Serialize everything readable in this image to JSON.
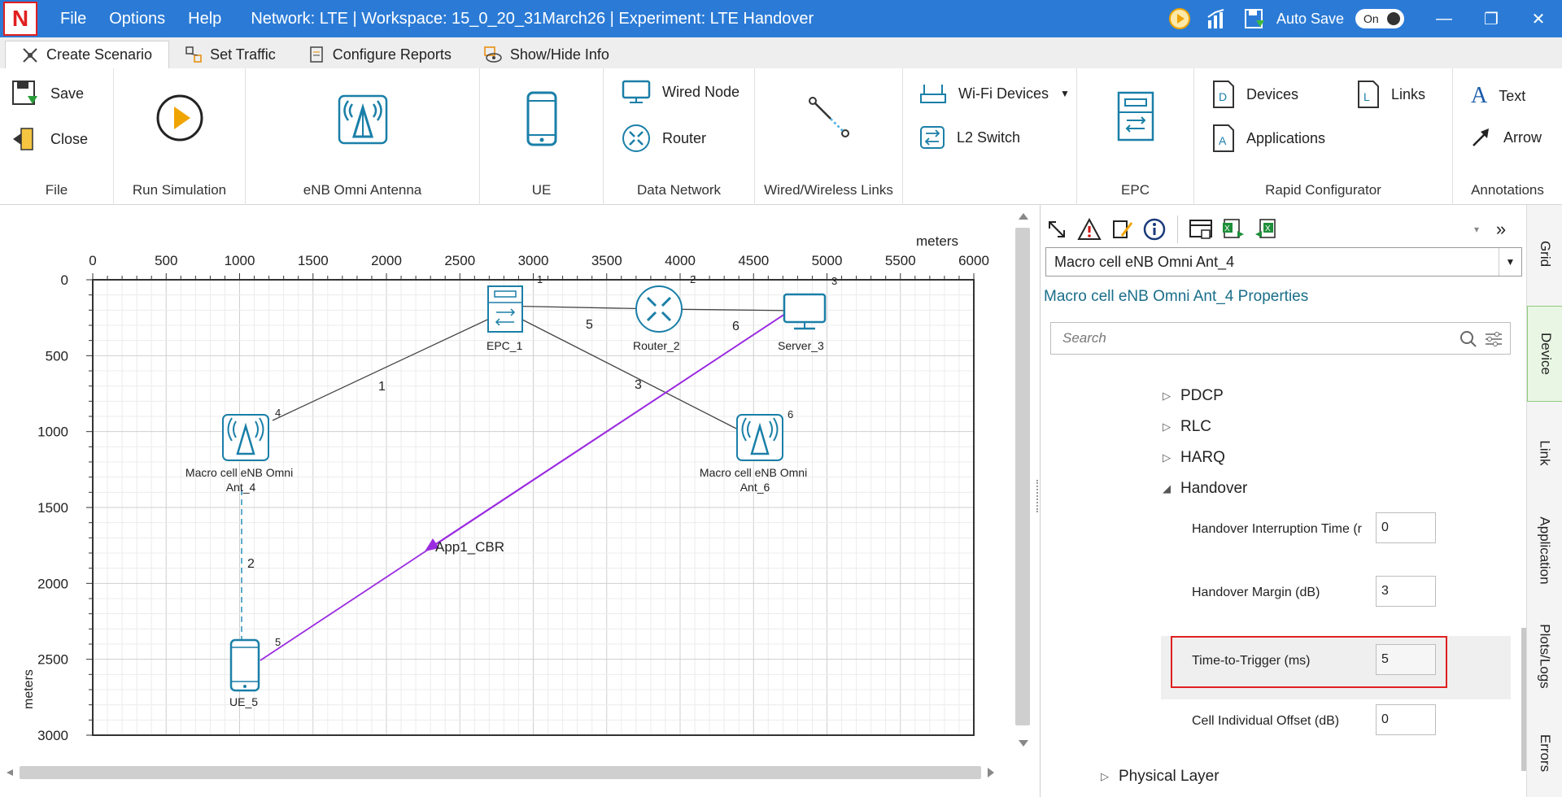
{
  "app": {
    "logo_letter": "N",
    "menu": [
      "File",
      "Options",
      "Help"
    ],
    "title": "Network: LTE | Workspace: 15_0_20_31March26 | Experiment: LTE Handover",
    "autosave_label": "Auto Save",
    "toggle_state": "On"
  },
  "tabs": [
    {
      "label": "Create Scenario"
    },
    {
      "label": "Set Traffic"
    },
    {
      "label": "Configure Reports"
    },
    {
      "label": "Show/Hide Info"
    }
  ],
  "ribbon": {
    "file": {
      "save": "Save",
      "close": "Close",
      "label": "File"
    },
    "run": {
      "label": "Run Simulation"
    },
    "enb": {
      "label": "eNB Omni Antenna"
    },
    "ue": {
      "label": "UE"
    },
    "data_network": {
      "wired_node": "Wired Node",
      "router": "Router",
      "label": "Data Network"
    },
    "links": {
      "label": "Wired/Wireless Links"
    },
    "wifi": {
      "wifi_devices": "Wi-Fi Devices",
      "l2_switch": "L2 Switch"
    },
    "epc": {
      "label": "EPC"
    },
    "rapid": {
      "devices": "Devices",
      "applications": "Applications",
      "links": "Links",
      "label": "Rapid Configurator"
    },
    "annotations": {
      "text": "Text",
      "arrow": "Arrow",
      "label": "Annotations"
    }
  },
  "canvas": {
    "unit_label": "meters",
    "x_ticks": [
      "0",
      "500",
      "1000",
      "1500",
      "2000",
      "2500",
      "3000",
      "3500",
      "4000",
      "4500",
      "5000",
      "5500",
      "6000"
    ],
    "y_ticks": [
      "0",
      "500",
      "1000",
      "1500",
      "2000",
      "2500",
      "3000"
    ],
    "y_unit_label": "meters",
    "devices": [
      {
        "name": "EPC_1",
        "id": "1",
        "x": 2800,
        "y": 150
      },
      {
        "name": "Router_2",
        "id": "2",
        "x": 3850,
        "y": 170
      },
      {
        "name": "Server_3",
        "id": "3",
        "x": 4750,
        "y": 180
      },
      {
        "name": "Macro cell eNB Omni Ant_4",
        "id": "4",
        "x": 1000,
        "y": 1020
      },
      {
        "name": "Macro cell eNB Omni Ant_6",
        "id": "6",
        "x": 4500,
        "y": 1020
      },
      {
        "name": "UE_5",
        "id": "5",
        "x": 1000,
        "y": 2520
      }
    ],
    "link_labels": [
      "1",
      "2",
      "3",
      "5",
      "6"
    ],
    "application_label": "App1_CBR"
  },
  "panel": {
    "device_select": "Macro cell eNB Omni Ant_4",
    "title": "Macro cell eNB Omni Ant_4 Properties",
    "search_placeholder": "Search",
    "tree": [
      "PDCP",
      "RLC",
      "HARQ",
      "Handover"
    ],
    "props": [
      {
        "label": "Handover Interruption Time (r",
        "value": "0"
      },
      {
        "label": "Handover Margin (dB)",
        "value": "3"
      },
      {
        "label": "Time-to-Trigger (ms)",
        "value": "5"
      },
      {
        "label": "Cell Individual Offset (dB)",
        "value": "0"
      }
    ],
    "physical_layer": "Physical Layer"
  },
  "side_tabs": [
    "Grid",
    "Device",
    "Link",
    "Application",
    "Plots/Logs",
    "Errors"
  ],
  "colors": {
    "titlebar": "#2b7bd6",
    "accent": "#1a7fa8",
    "app_flow": "#9b2be0",
    "highlight": "#e02020"
  }
}
